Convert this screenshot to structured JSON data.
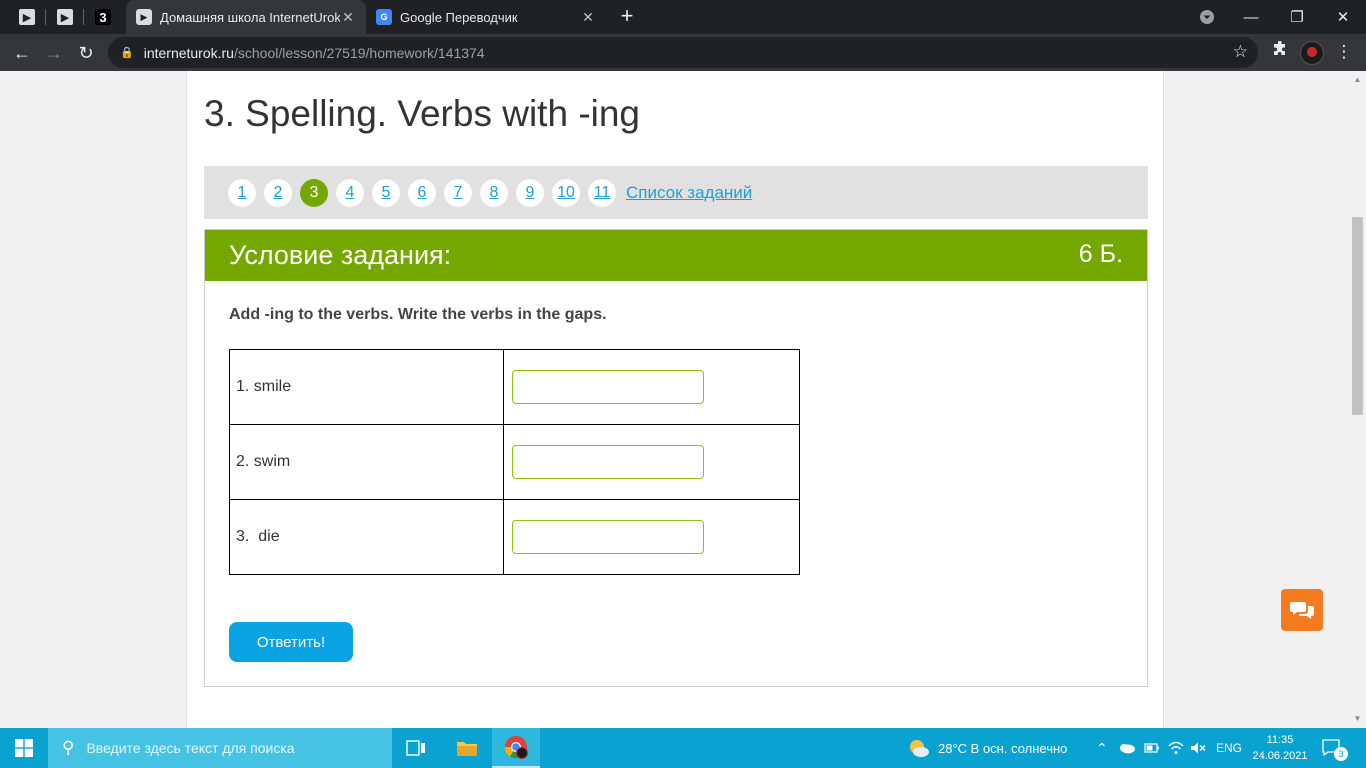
{
  "browser": {
    "pinned_tabs": [
      {
        "icon": "internet-urok-icon",
        "label": "▶"
      },
      {
        "icon": "internet-urok-icon",
        "label": "▶"
      },
      {
        "icon": "tab-3-icon",
        "label": "3"
      }
    ],
    "tabs": [
      {
        "title": "Домашняя школа InternetUrok.ru",
        "active": true,
        "favicon": "internet-urok-icon"
      },
      {
        "title": "Google Переводчик",
        "active": false,
        "favicon": "google-translate-icon"
      }
    ],
    "url": {
      "host": "interneturok.ru",
      "path": "/school/lesson/27519/homework/141374"
    }
  },
  "page": {
    "title": "3. Spelling. Verbs with -ing",
    "pagination": {
      "pages": [
        "1",
        "2",
        "3",
        "4",
        "5",
        "6",
        "7",
        "8",
        "9",
        "10",
        "11"
      ],
      "current": "3",
      "task_list_label": "Список заданий"
    },
    "task": {
      "header": "Условие задания:",
      "score": "6 Б.",
      "instruction": "Add -ing to the verbs. Write the verbs in the gaps.",
      "rows": [
        {
          "verb": "1. smile",
          "answer": ""
        },
        {
          "verb": "2. swim",
          "answer": ""
        },
        {
          "verb": "3.  die",
          "answer": ""
        }
      ],
      "submit_label": "Ответить!"
    }
  },
  "colors": {
    "accent_green": "#74a800",
    "button_blue": "#0aa3e4",
    "link_blue": "#1f9fd7",
    "chat_orange": "#f47b20",
    "taskbar": "#0aa3d1"
  },
  "taskbar": {
    "search_placeholder": "Введите здесь текст для поиска",
    "weather": "28°C  В осн. солнечно",
    "language": "ENG",
    "time": "11:35",
    "date": "24.06.2021",
    "notifications": "3"
  }
}
